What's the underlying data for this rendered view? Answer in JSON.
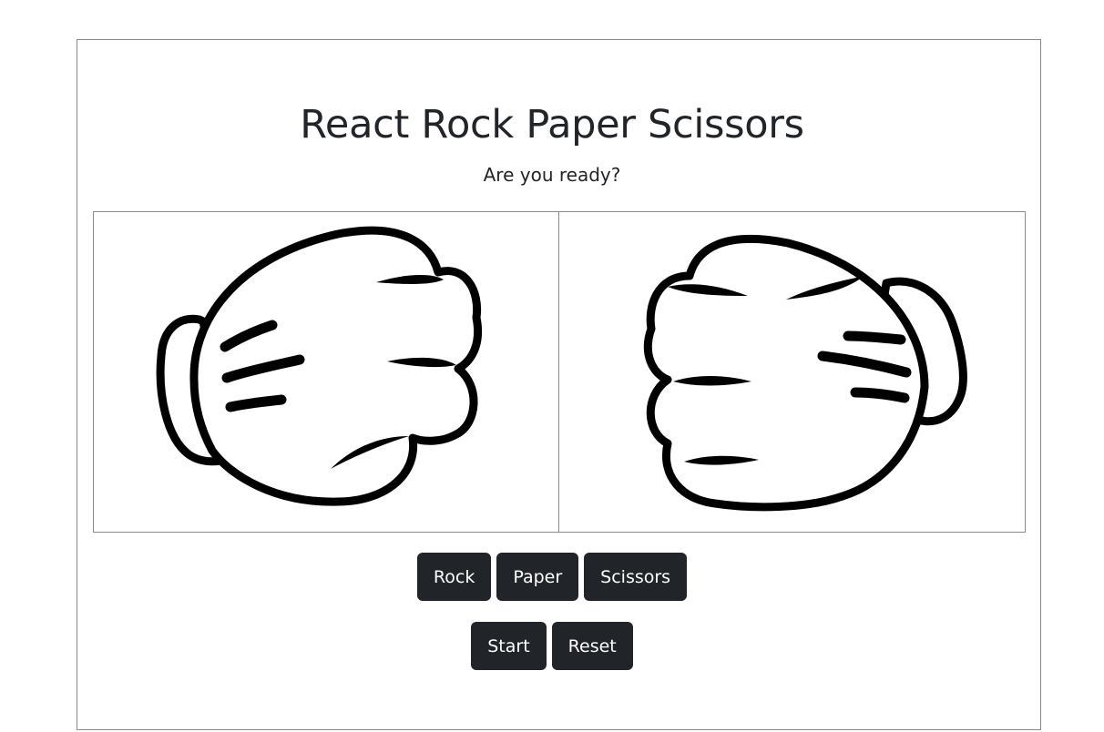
{
  "game": {
    "title": "React Rock Paper Scissors",
    "status": "Are you ready?"
  },
  "players": [
    {
      "hand": "rock",
      "icon": "fist-icon"
    },
    {
      "hand": "rock",
      "icon": "fist-icon"
    }
  ],
  "choices": {
    "rock_label": "Rock",
    "paper_label": "Paper",
    "scissors_label": "Scissors"
  },
  "controls": {
    "start_label": "Start",
    "reset_label": "Reset"
  },
  "colors": {
    "button_bg": "#212529",
    "button_text": "#ffffff",
    "outline": "#000000"
  }
}
